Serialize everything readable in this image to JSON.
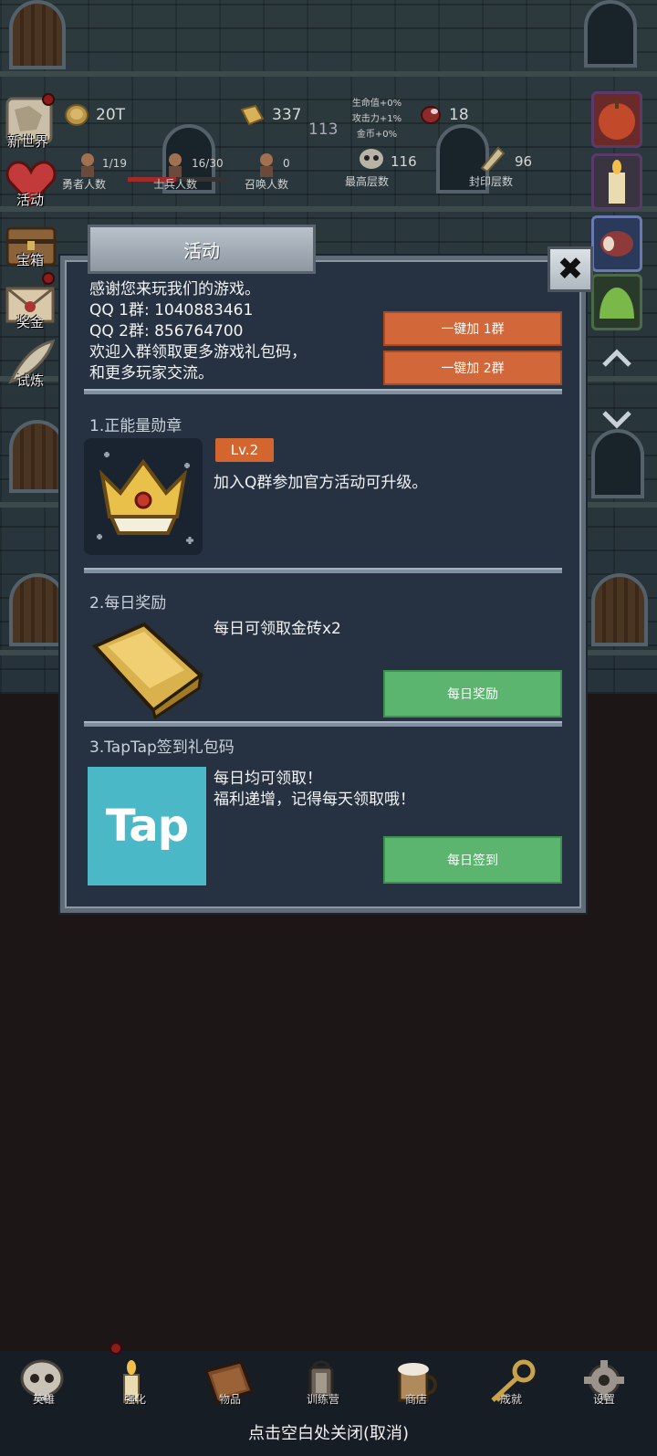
{
  "hud": {
    "coins": "20T",
    "gold_bricks": "337",
    "floor_sub": "113",
    "meat": "18",
    "bonus_hp": "生命值+0%",
    "bonus_atk": "攻击力+1%",
    "bonus_gold": "金币+0%",
    "heroes_count": "1/19",
    "heroes_label": "勇者人数",
    "soldiers_count": "16/30",
    "soldiers_label": "士兵人数",
    "summons_count": "0",
    "summons_label": "召唤人数",
    "max_floor": "116",
    "max_floor_label": "最高层数",
    "seal_floor": "96",
    "seal_floor_label": "封印层数"
  },
  "side_menu": [
    {
      "label": "新世界"
    },
    {
      "label": "活动"
    },
    {
      "label": "宝箱"
    },
    {
      "label": "奖金"
    },
    {
      "label": "试炼"
    }
  ],
  "dialog": {
    "title": "活动",
    "close_glyph": "✖",
    "intro": {
      "line1": "感谢您来玩我们的游戏。",
      "line2": "QQ 1群: 1040883461",
      "line3": "QQ 2群: 856764700",
      "line4": "欢迎入群领取更多游戏礼包码，",
      "line5": "和更多玩家交流。",
      "join1_label": "一键加 1群",
      "join2_label": "一键加 2群"
    },
    "section1": {
      "title": "1.正能量勋章",
      "level": "Lv.2",
      "desc": "加入Q群参加官方活动可升级。"
    },
    "section2": {
      "title": "2.每日奖励",
      "desc": "每日可领取金砖x2",
      "button": "每日奖励"
    },
    "section3": {
      "title": "3.TapTap签到礼包码",
      "logo_text": "Tap",
      "desc1": "每日均可领取！",
      "desc2": "福利递增，记得每天领取哦！",
      "button": "每日签到"
    }
  },
  "bottom_nav": [
    {
      "label": "英雄"
    },
    {
      "label": "强化"
    },
    {
      "label": "物品"
    },
    {
      "label": "训练营"
    },
    {
      "label": "商店"
    },
    {
      "label": "成就"
    },
    {
      "label": "设置"
    }
  ],
  "close_hint": "点击空白处关闭(取消)",
  "colors": {
    "dialog_bg": "#263241",
    "orange_button": "#d2673a",
    "green_button": "#5bb56f",
    "tap_brand": "#4bb8c8"
  }
}
